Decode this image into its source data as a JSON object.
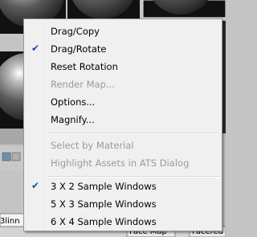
{
  "background": {
    "labels": [
      "3linn",
      "Face Map",
      "Facered"
    ]
  },
  "menu": {
    "items": [
      {
        "label": "Drag/Copy",
        "enabled": true,
        "checked": false
      },
      {
        "label": "Drag/Rotate",
        "enabled": true,
        "checked": true
      },
      {
        "label": "Reset Rotation",
        "enabled": true,
        "checked": false
      },
      {
        "label": "Render Map...",
        "enabled": false,
        "checked": false
      },
      {
        "label": "Options...",
        "enabled": true,
        "checked": false
      },
      {
        "label": "Magnify...",
        "enabled": true,
        "checked": false
      },
      {
        "label": "Select by Material",
        "enabled": false,
        "checked": false
      },
      {
        "label": "Highlight Assets in ATS Dialog",
        "enabled": false,
        "checked": false
      },
      {
        "label": "3 X 2 Sample Windows",
        "enabled": true,
        "checked": true
      },
      {
        "label": "5 X 3 Sample Windows",
        "enabled": true,
        "checked": false
      },
      {
        "label": "6 X 4 Sample Windows",
        "enabled": true,
        "checked": false
      }
    ],
    "check_glyph": "✔",
    "colors": {
      "check": "#1d4ea3",
      "disabled_text": "#9a9a9a",
      "menu_bg": "#f0f0f0"
    }
  }
}
